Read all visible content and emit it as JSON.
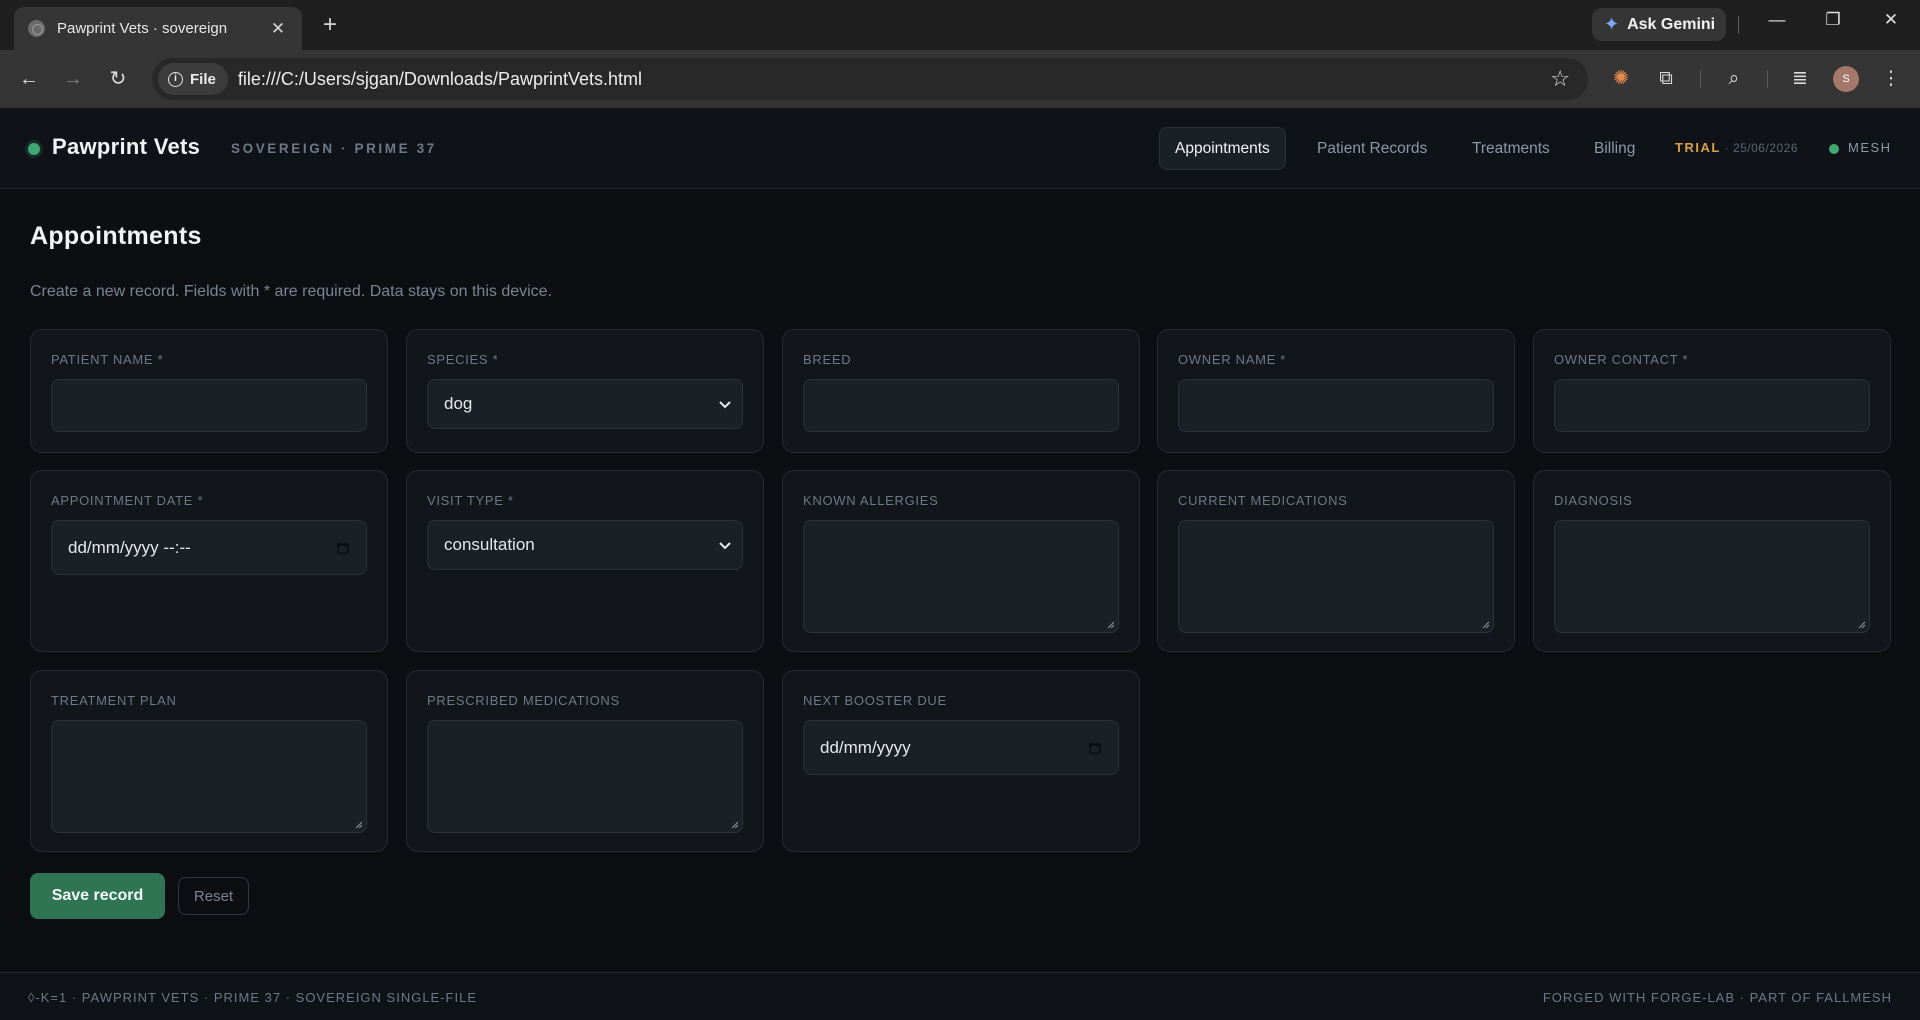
{
  "browser": {
    "tab_title": "Pawprint Vets · sovereign",
    "tab_close": "✕",
    "new_tab": "+",
    "ask_gemini": "Ask Gemini",
    "url_chip": "File",
    "url": "file:///C:/Users/sjgan/Downloads/PawprintVets.html",
    "avatar_initial": "S"
  },
  "header": {
    "brand": "Pawprint Vets",
    "subtitle": "SOVEREIGN · PRIME 37",
    "nav": [
      {
        "label": "Appointments",
        "active": true
      },
      {
        "label": "Patient Records"
      },
      {
        "label": "Treatments"
      },
      {
        "label": "Billing"
      }
    ],
    "trial_label": "TRIAL",
    "trial_date": " · 25/06/2026",
    "mesh_label": "MESH",
    "status_color": "#3fa774",
    "trial_color": "#d9a04a"
  },
  "page": {
    "title": "Appointments",
    "description": "Create a new record. Fields with * are required. Data stays on this device."
  },
  "form": {
    "patient_name": {
      "label": "PATIENT NAME *",
      "value": ""
    },
    "species": {
      "label": "SPECIES *",
      "value": "dog"
    },
    "breed": {
      "label": "BREED",
      "value": ""
    },
    "owner_name": {
      "label": "OWNER NAME *",
      "value": ""
    },
    "owner_contact": {
      "label": "OWNER CONTACT *",
      "value": ""
    },
    "appointment_date": {
      "label": "APPOINTMENT DATE *",
      "value": "dd/mm/yyyy --:--"
    },
    "visit_type": {
      "label": "VISIT TYPE *",
      "value": "consultation"
    },
    "known_allergies": {
      "label": "KNOWN ALLERGIES",
      "value": ""
    },
    "current_medications": {
      "label": "CURRENT MEDICATIONS",
      "value": ""
    },
    "diagnosis": {
      "label": "DIAGNOSIS",
      "value": ""
    },
    "treatment_plan": {
      "label": "TREATMENT PLAN",
      "value": ""
    },
    "prescribed_medications": {
      "label": "PRESCRIBED MEDICATIONS",
      "value": ""
    },
    "next_booster_due": {
      "label": "NEXT BOOSTER DUE",
      "value": "dd/mm/yyyy"
    }
  },
  "actions": {
    "save": "Save record",
    "reset": "Reset",
    "save_color": "#2f7553"
  },
  "footer": {
    "left": "◊-K=1 · PAWPRINT VETS · PRIME 37 · SOVEREIGN SINGLE-FILE",
    "right": "FORGED WITH FORGE-LAB · PART OF FALLMESH"
  }
}
